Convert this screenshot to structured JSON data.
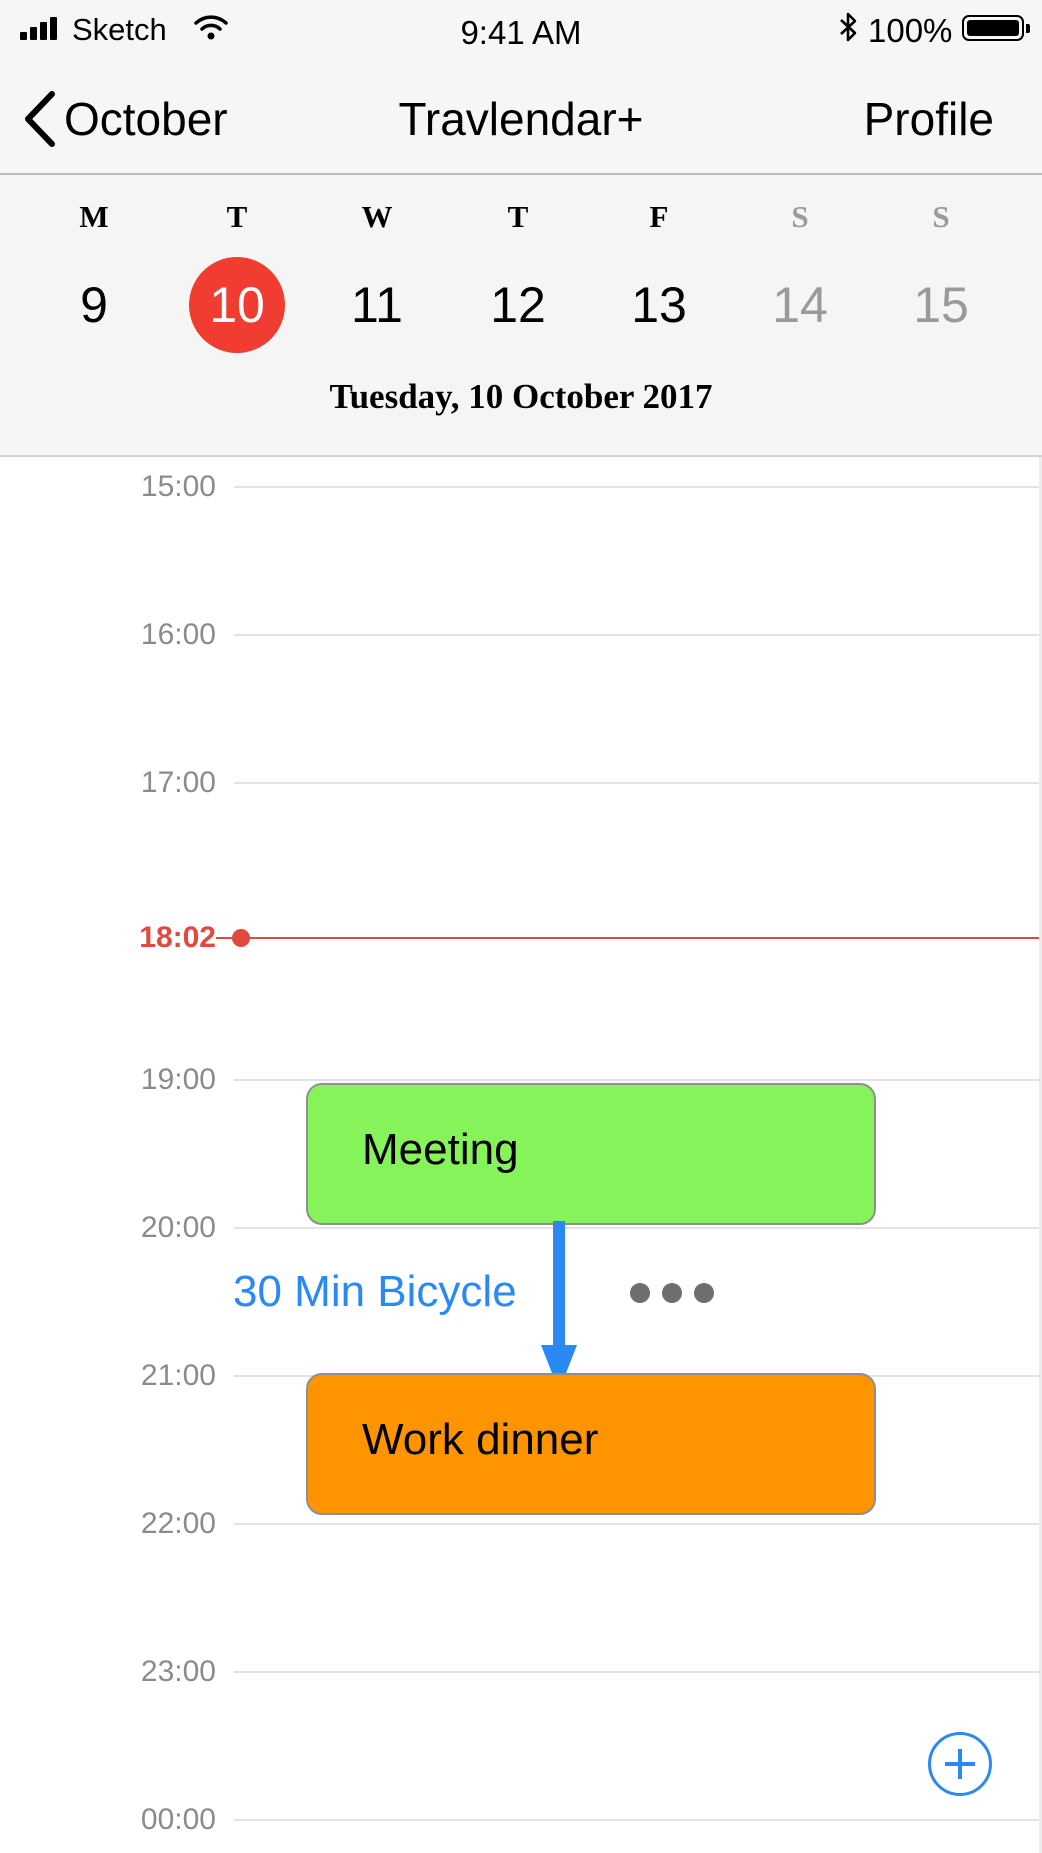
{
  "status_bar": {
    "carrier": "Sketch",
    "time": "9:41 AM",
    "battery": "100%",
    "icons": [
      "signal-icon",
      "wifi-icon",
      "bluetooth-icon",
      "battery-icon"
    ]
  },
  "nav": {
    "back_label": "October",
    "title": "Travlendar+",
    "right_label": "Profile"
  },
  "week": {
    "days": [
      {
        "dow": "M",
        "num": "9"
      },
      {
        "dow": "T",
        "num": "10"
      },
      {
        "dow": "W",
        "num": "11"
      },
      {
        "dow": "T",
        "num": "12"
      },
      {
        "dow": "F",
        "num": "13"
      },
      {
        "dow": "S",
        "num": "14"
      },
      {
        "dow": "S",
        "num": "15"
      }
    ],
    "selected_date_title": "Tuesday, 10 October 2017"
  },
  "timeline": {
    "hours": [
      "15:00",
      "16:00",
      "17:00",
      "18:02",
      "19:00",
      "20:00",
      "21:00",
      "22:00",
      "23:00",
      "00:00"
    ],
    "now_marker": "18:02",
    "events": [
      {
        "title": "Meeting",
        "color": "#87f35b"
      },
      {
        "title": "Work dinner",
        "color": "#fd9400"
      }
    ],
    "travel": {
      "label": "30 Min Bicycle",
      "color": "#2b89f4"
    }
  },
  "colors": {
    "accent": "#2b89f4",
    "today": "#f03c31",
    "now_line": "#e1493f"
  }
}
